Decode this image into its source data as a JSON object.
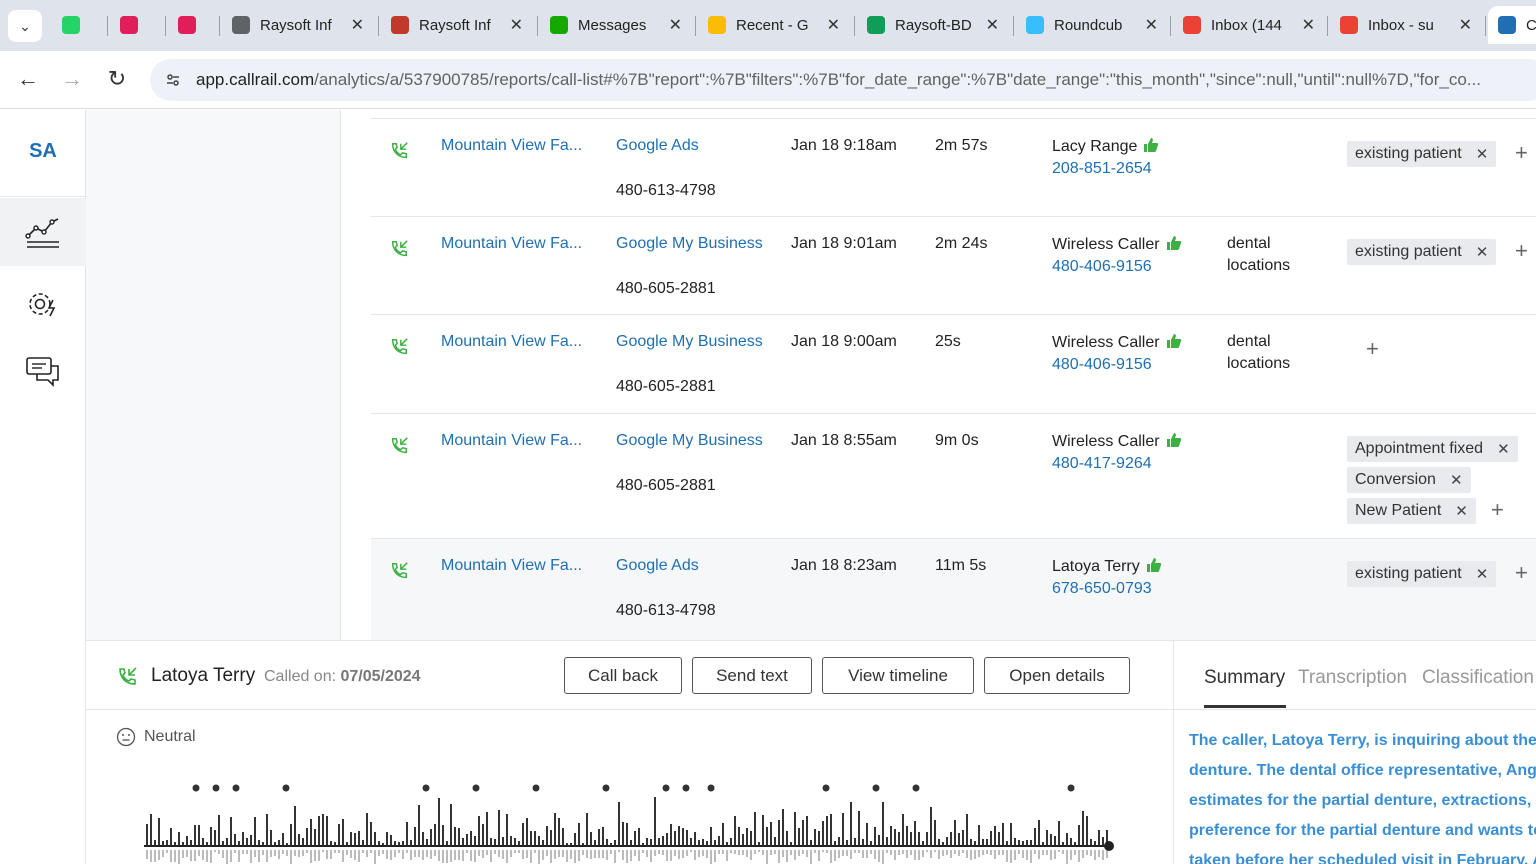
{
  "browser": {
    "tabs": [
      {
        "label": "",
        "icon": "whatsapp-icon",
        "color": "#25d366"
      },
      {
        "label": "",
        "icon": "slack-icon",
        "color": "#e01e5a"
      },
      {
        "label": "",
        "icon": "slack-icon",
        "color": "#e01e5a"
      },
      {
        "label": "Raysoft Inf",
        "icon": "globe-icon",
        "color": "#5f6368"
      },
      {
        "label": "Raysoft Inf",
        "icon": "raysoft-icon",
        "color": "#c0392b"
      },
      {
        "label": "Messages",
        "icon": "upwork-icon",
        "color": "#14a800"
      },
      {
        "label": "Recent - G",
        "icon": "google-drive-icon",
        "color": "#fbbc04"
      },
      {
        "label": "Raysoft-BD",
        "icon": "google-sheets-icon",
        "color": "#0f9d58"
      },
      {
        "label": "Roundcub",
        "icon": "roundcube-icon",
        "color": "#37beff"
      },
      {
        "label": "Inbox (144",
        "icon": "gmail-icon",
        "color": "#ea4335"
      },
      {
        "label": "Inbox - su",
        "icon": "gmail-icon",
        "color": "#ea4335"
      },
      {
        "label": "C",
        "icon": "callrail-icon",
        "color": "#1f6fb2"
      }
    ],
    "url_host": "app.callrail.com",
    "url_path": "/analytics/a/537900785/reports/call-list#%7B\"report\":%7B\"filters\":%7B\"for_date_range\":%7B\"date_range\":\"this_month\",\"since\":null,\"until\":null%7D,\"for_co..."
  },
  "sidebar": {
    "account_initials": "SA"
  },
  "calls": [
    {
      "company": "Mountain View Fa...",
      "source": "Google Ads",
      "tracking_number": "480-613-4798",
      "date": "Jan 18 9:18am",
      "duration": "2m 57s",
      "caller_name": "Lacy Range",
      "caller_phone": "208-851-2654",
      "keyword": "",
      "tags": [
        "existing patient"
      ]
    },
    {
      "company": "Mountain View Fa...",
      "source": "Google My Business",
      "tracking_number": "480-605-2881",
      "date": "Jan 18 9:01am",
      "duration": "2m 24s",
      "caller_name": "Wireless Caller",
      "caller_phone": "480-406-9156",
      "keyword": "dental locations",
      "tags": [
        "existing patient"
      ]
    },
    {
      "company": "Mountain View Fa...",
      "source": "Google My Business",
      "tracking_number": "480-605-2881",
      "date": "Jan 18 9:00am",
      "duration": "25s",
      "caller_name": "Wireless Caller",
      "caller_phone": "480-406-9156",
      "keyword": "dental locations",
      "tags": []
    },
    {
      "company": "Mountain View Fa...",
      "source": "Google My Business",
      "tracking_number": "480-605-2881",
      "date": "Jan 18 8:55am",
      "duration": "9m 0s",
      "caller_name": "Wireless Caller",
      "caller_phone": "480-417-9264",
      "keyword": "",
      "tags": [
        "Appointment fixed",
        "Conversion",
        "New Patient"
      ]
    },
    {
      "company": "Mountain View Fa...",
      "source": "Google Ads",
      "tracking_number": "480-613-4798",
      "date": "Jan 18 8:23am",
      "duration": "11m 5s",
      "caller_name": "Latoya Terry",
      "caller_phone": "678-650-0793",
      "keyword": "",
      "tags": [
        "existing patient"
      ]
    }
  ],
  "detail": {
    "caller_name": "Latoya Terry",
    "called_on_label": "Called on:",
    "called_on_date": "07/05/2024",
    "buttons": {
      "call_back": "Call back",
      "send_text": "Send text",
      "view_timeline": "View timeline",
      "open_details": "Open details"
    },
    "sentiment": "Neutral",
    "tabs": {
      "summary": "Summary",
      "transcription": "Transcription",
      "classification": "Classification"
    },
    "summary_lines": [
      "The caller, Latoya Terry, is inquiring about the c",
      "denture. The dental office representative, Ange",
      "estimates for the partial denture, extractions, a",
      "preference for the partial denture and wants to",
      "taken before her scheduled visit in February. A"
    ]
  },
  "colors": {
    "link": "#1f6fb2",
    "thumb": "#3cb043",
    "summary_text": "#3a8fd4",
    "call_icon": "#3cb043"
  }
}
